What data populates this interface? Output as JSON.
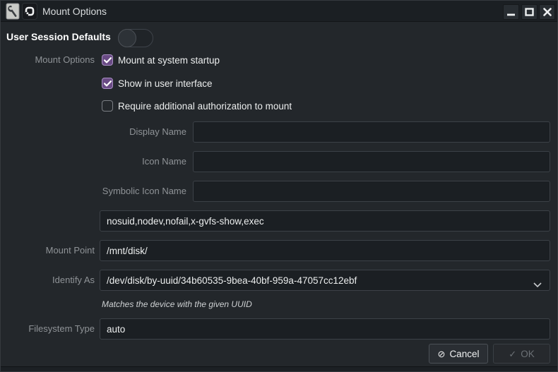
{
  "window": {
    "title": "Mount Options",
    "controls": {
      "minimize": "minimize",
      "maximize": "maximize",
      "close": "close"
    }
  },
  "session": {
    "label": "User Session Defaults",
    "enabled": false
  },
  "form": {
    "mount_options": {
      "label": "Mount Options",
      "checkboxes": [
        {
          "label": "Mount at system startup",
          "checked": true
        },
        {
          "label": "Show in user interface",
          "checked": true
        },
        {
          "label": "Require additional authorization to mount",
          "checked": false
        }
      ]
    },
    "display_name": {
      "label": "Display Name",
      "value": ""
    },
    "icon_name": {
      "label": "Icon Name",
      "value": ""
    },
    "symbolic_icon_name": {
      "label": "Symbolic Icon Name",
      "value": ""
    },
    "options": {
      "value": "nosuid,nodev,nofail,x-gvfs-show,exec"
    },
    "mount_point": {
      "label": "Mount Point",
      "value": "/mnt/disk/"
    },
    "identify_as": {
      "label": "Identify As",
      "value": "/dev/disk/by-uuid/34b60535-9bea-40bf-959a-47057cc12ebf",
      "hint": "Matches the device with the given UUID"
    },
    "filesystem_type": {
      "label": "Filesystem Type",
      "value": "auto"
    }
  },
  "actions": {
    "cancel_label": "Cancel",
    "cancel_icon": "⊘",
    "ok_label": "OK",
    "ok_icon": "✓",
    "ok_enabled": false
  },
  "colors": {
    "checkbox_accent": "#6a4b85",
    "checkbox_border": "#a98fc4",
    "content_bg": "#23272b",
    "titlebar_bg": "#1b1f23",
    "input_bg": "#1b1f23",
    "label_gray": "#8f9397"
  }
}
